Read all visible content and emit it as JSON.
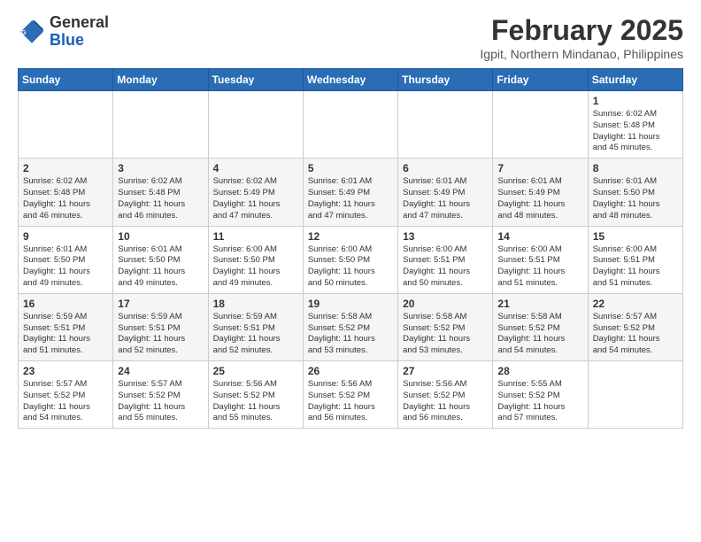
{
  "header": {
    "logo_general": "General",
    "logo_blue": "Blue",
    "month_year": "February 2025",
    "location": "Igpit, Northern Mindanao, Philippines"
  },
  "weekdays": [
    "Sunday",
    "Monday",
    "Tuesday",
    "Wednesday",
    "Thursday",
    "Friday",
    "Saturday"
  ],
  "weeks": [
    [
      {
        "day": null,
        "info": null
      },
      {
        "day": null,
        "info": null
      },
      {
        "day": null,
        "info": null
      },
      {
        "day": null,
        "info": null
      },
      {
        "day": null,
        "info": null
      },
      {
        "day": null,
        "info": null
      },
      {
        "day": "1",
        "info": "Sunrise: 6:02 AM\nSunset: 5:48 PM\nDaylight: 11 hours\nand 45 minutes."
      }
    ],
    [
      {
        "day": "2",
        "info": "Sunrise: 6:02 AM\nSunset: 5:48 PM\nDaylight: 11 hours\nand 46 minutes."
      },
      {
        "day": "3",
        "info": "Sunrise: 6:02 AM\nSunset: 5:48 PM\nDaylight: 11 hours\nand 46 minutes."
      },
      {
        "day": "4",
        "info": "Sunrise: 6:02 AM\nSunset: 5:49 PM\nDaylight: 11 hours\nand 47 minutes."
      },
      {
        "day": "5",
        "info": "Sunrise: 6:01 AM\nSunset: 5:49 PM\nDaylight: 11 hours\nand 47 minutes."
      },
      {
        "day": "6",
        "info": "Sunrise: 6:01 AM\nSunset: 5:49 PM\nDaylight: 11 hours\nand 47 minutes."
      },
      {
        "day": "7",
        "info": "Sunrise: 6:01 AM\nSunset: 5:49 PM\nDaylight: 11 hours\nand 48 minutes."
      },
      {
        "day": "8",
        "info": "Sunrise: 6:01 AM\nSunset: 5:50 PM\nDaylight: 11 hours\nand 48 minutes."
      }
    ],
    [
      {
        "day": "9",
        "info": "Sunrise: 6:01 AM\nSunset: 5:50 PM\nDaylight: 11 hours\nand 49 minutes."
      },
      {
        "day": "10",
        "info": "Sunrise: 6:01 AM\nSunset: 5:50 PM\nDaylight: 11 hours\nand 49 minutes."
      },
      {
        "day": "11",
        "info": "Sunrise: 6:00 AM\nSunset: 5:50 PM\nDaylight: 11 hours\nand 49 minutes."
      },
      {
        "day": "12",
        "info": "Sunrise: 6:00 AM\nSunset: 5:50 PM\nDaylight: 11 hours\nand 50 minutes."
      },
      {
        "day": "13",
        "info": "Sunrise: 6:00 AM\nSunset: 5:51 PM\nDaylight: 11 hours\nand 50 minutes."
      },
      {
        "day": "14",
        "info": "Sunrise: 6:00 AM\nSunset: 5:51 PM\nDaylight: 11 hours\nand 51 minutes."
      },
      {
        "day": "15",
        "info": "Sunrise: 6:00 AM\nSunset: 5:51 PM\nDaylight: 11 hours\nand 51 minutes."
      }
    ],
    [
      {
        "day": "16",
        "info": "Sunrise: 5:59 AM\nSunset: 5:51 PM\nDaylight: 11 hours\nand 51 minutes."
      },
      {
        "day": "17",
        "info": "Sunrise: 5:59 AM\nSunset: 5:51 PM\nDaylight: 11 hours\nand 52 minutes."
      },
      {
        "day": "18",
        "info": "Sunrise: 5:59 AM\nSunset: 5:51 PM\nDaylight: 11 hours\nand 52 minutes."
      },
      {
        "day": "19",
        "info": "Sunrise: 5:58 AM\nSunset: 5:52 PM\nDaylight: 11 hours\nand 53 minutes."
      },
      {
        "day": "20",
        "info": "Sunrise: 5:58 AM\nSunset: 5:52 PM\nDaylight: 11 hours\nand 53 minutes."
      },
      {
        "day": "21",
        "info": "Sunrise: 5:58 AM\nSunset: 5:52 PM\nDaylight: 11 hours\nand 54 minutes."
      },
      {
        "day": "22",
        "info": "Sunrise: 5:57 AM\nSunset: 5:52 PM\nDaylight: 11 hours\nand 54 minutes."
      }
    ],
    [
      {
        "day": "23",
        "info": "Sunrise: 5:57 AM\nSunset: 5:52 PM\nDaylight: 11 hours\nand 54 minutes."
      },
      {
        "day": "24",
        "info": "Sunrise: 5:57 AM\nSunset: 5:52 PM\nDaylight: 11 hours\nand 55 minutes."
      },
      {
        "day": "25",
        "info": "Sunrise: 5:56 AM\nSunset: 5:52 PM\nDaylight: 11 hours\nand 55 minutes."
      },
      {
        "day": "26",
        "info": "Sunrise: 5:56 AM\nSunset: 5:52 PM\nDaylight: 11 hours\nand 56 minutes."
      },
      {
        "day": "27",
        "info": "Sunrise: 5:56 AM\nSunset: 5:52 PM\nDaylight: 11 hours\nand 56 minutes."
      },
      {
        "day": "28",
        "info": "Sunrise: 5:55 AM\nSunset: 5:52 PM\nDaylight: 11 hours\nand 57 minutes."
      },
      {
        "day": null,
        "info": null
      }
    ]
  ]
}
